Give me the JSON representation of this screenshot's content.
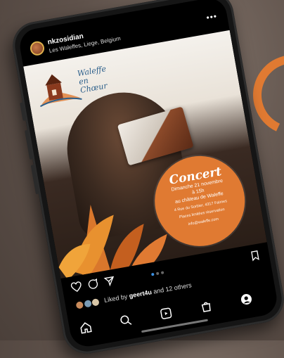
{
  "post_header": {
    "username": "nkzosidian",
    "location": "Les Waleffes, Liege, Belgium",
    "more_glyph": "•••"
  },
  "post_image": {
    "logo_text": "Waleffe en Chœur",
    "concert": {
      "title": "Concert",
      "date_line_1": "Dimanche 21 novembre",
      "date_line_2": "à 15h",
      "venue_line_1": "au château de Waleffe",
      "address": "4 Rue du Sorbier, 4317 Faimes",
      "info_line": "Places limitées réservation",
      "website": "info@waleffe.com"
    }
  },
  "actions": {
    "like_icon": "heart-icon",
    "comment_icon": "comment-icon",
    "share_icon": "send-icon",
    "save_icon": "bookmark-icon",
    "carousel_count": 3,
    "carousel_active": 0
  },
  "likes": {
    "prefix": "Liked by",
    "user": "geert4u",
    "suffix": "and 12 others"
  },
  "bottom_nav": {
    "items": [
      "home-icon",
      "search-icon",
      "reels-icon",
      "shop-icon",
      "profile-icon"
    ]
  },
  "colors": {
    "accent": "#e07a32",
    "carousel_active": "#3b8fe0"
  }
}
